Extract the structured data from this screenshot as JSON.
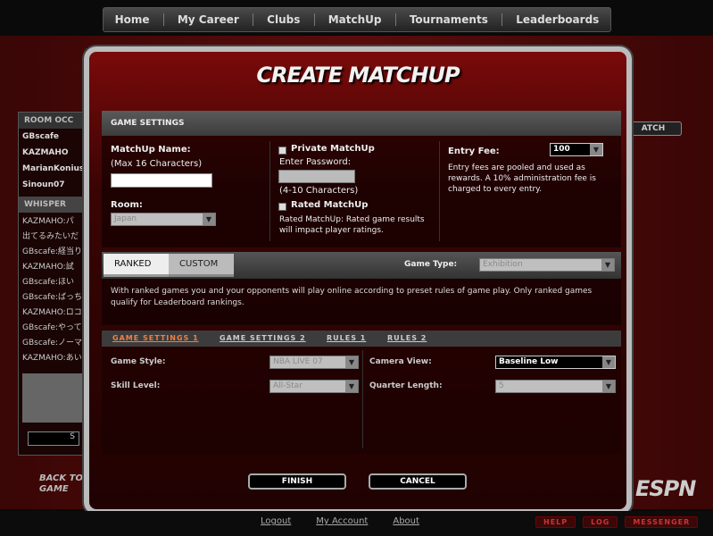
{
  "topnav": {
    "items": [
      "Home",
      "My Career",
      "Clubs",
      "MatchUp",
      "Tournaments",
      "Leaderboards"
    ]
  },
  "background": {
    "room_header": "ROOM OCC",
    "users": [
      "GBscafe",
      "KAZMAHO",
      "MarianKonius",
      "Sinoun07"
    ],
    "whisper_label": "WHISPER",
    "chat_lines": [
      "KAZMAHO:パ",
      "出てるみたいだ",
      "GBscafe:経当り",
      "KAZMAHO:試",
      "GBscafe:ほい",
      "GBscafe:ばっち",
      "KAZMAHO:ロコ",
      "GBscafe:やって",
      "GBscafe:ノーマ",
      "KAZMAHO:あい"
    ],
    "left_button": "S",
    "back_to_game": "BACK TO GAME",
    "right_button": "ATCH",
    "espn": "ESPN"
  },
  "modal": {
    "title": "CREATE MATCHUP",
    "section_header": "GAME SETTINGS",
    "matchup_name_label": "MatchUp Name:",
    "matchup_name_hint": "(Max 16 Characters)",
    "matchup_name_value": "",
    "room_label": "Room:",
    "room_value": "Japan",
    "private_label": "Private MatchUp",
    "enter_password_label": "Enter Password:",
    "password_hint": "(4-10 Characters)",
    "rated_label": "Rated MatchUp",
    "rated_desc": "Rated MatchUp: Rated game results will impact player ratings.",
    "entry_fee_label": "Entry Fee:",
    "entry_fee_value": "100",
    "entry_fee_desc": "Entry fees are pooled and used as rewards. A 10% administration fee is charged to every entry.",
    "tabs": [
      "RANKED",
      "CUSTOM"
    ],
    "game_type_label": "Game Type:",
    "game_type_value": "Exhibition",
    "ranked_desc": "With ranked games you and your opponents will play online according to preset rules of game play. Only ranked games qualify for Leaderboard rankings.",
    "subtabs": [
      "GAME SETTINGS 1",
      "GAME SETTINGS 2",
      "RULES 1",
      "RULES 2"
    ],
    "game_style_label": "Game Style:",
    "game_style_value": "NBA LIVE 07",
    "skill_level_label": "Skill Level:",
    "skill_level_value": "All-Star",
    "camera_view_label": "Camera View:",
    "camera_view_value": "Baseline Low",
    "quarter_length_label": "Quarter Length:",
    "quarter_length_value": "5",
    "finish_label": "FINISH",
    "cancel_label": "CANCEL"
  },
  "bottombar": {
    "links": [
      "Logout",
      "My Account",
      "About"
    ],
    "buttons": [
      "HELP",
      "LOG",
      "MESSENGER"
    ]
  },
  "colors": {
    "accent": "#f08040",
    "modal_border": "#bcbcbc",
    "background_red": "#5a0c0c"
  }
}
